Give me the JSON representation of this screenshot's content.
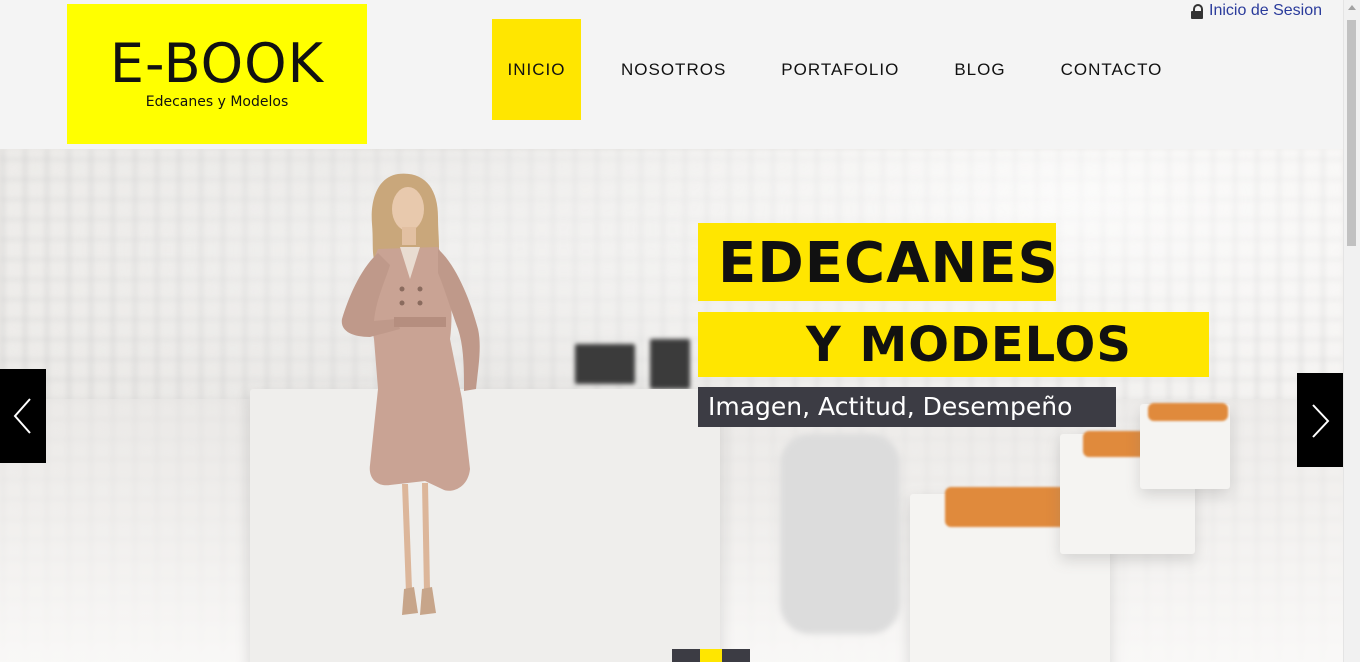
{
  "header": {
    "logo": {
      "title": "E-BOOK",
      "subtitle": "Edecanes y Modelos"
    },
    "login": {
      "icon": "lock-icon",
      "label": "Inicio de Sesion"
    },
    "nav": [
      {
        "label": "INICIO",
        "active": true
      },
      {
        "label": "NOSOTROS",
        "active": false
      },
      {
        "label": "PORTAFOLIO",
        "active": false
      },
      {
        "label": "BLOG",
        "active": false
      },
      {
        "label": "CONTACTO",
        "active": false
      }
    ]
  },
  "hero": {
    "headline_line1": "EDECANES",
    "headline_line2": "Y MODELOS",
    "tagline": "Imagen, Actitud, Desempeño",
    "prev_icon": "chevron-left-icon",
    "next_icon": "chevron-right-icon",
    "slides": 2,
    "active_slide": 2
  },
  "colors": {
    "accent_yellow": "#ffe600",
    "logo_yellow": "#ffff00",
    "dark_panel": "#3c3c44",
    "link_blue": "#2a3b9b"
  }
}
